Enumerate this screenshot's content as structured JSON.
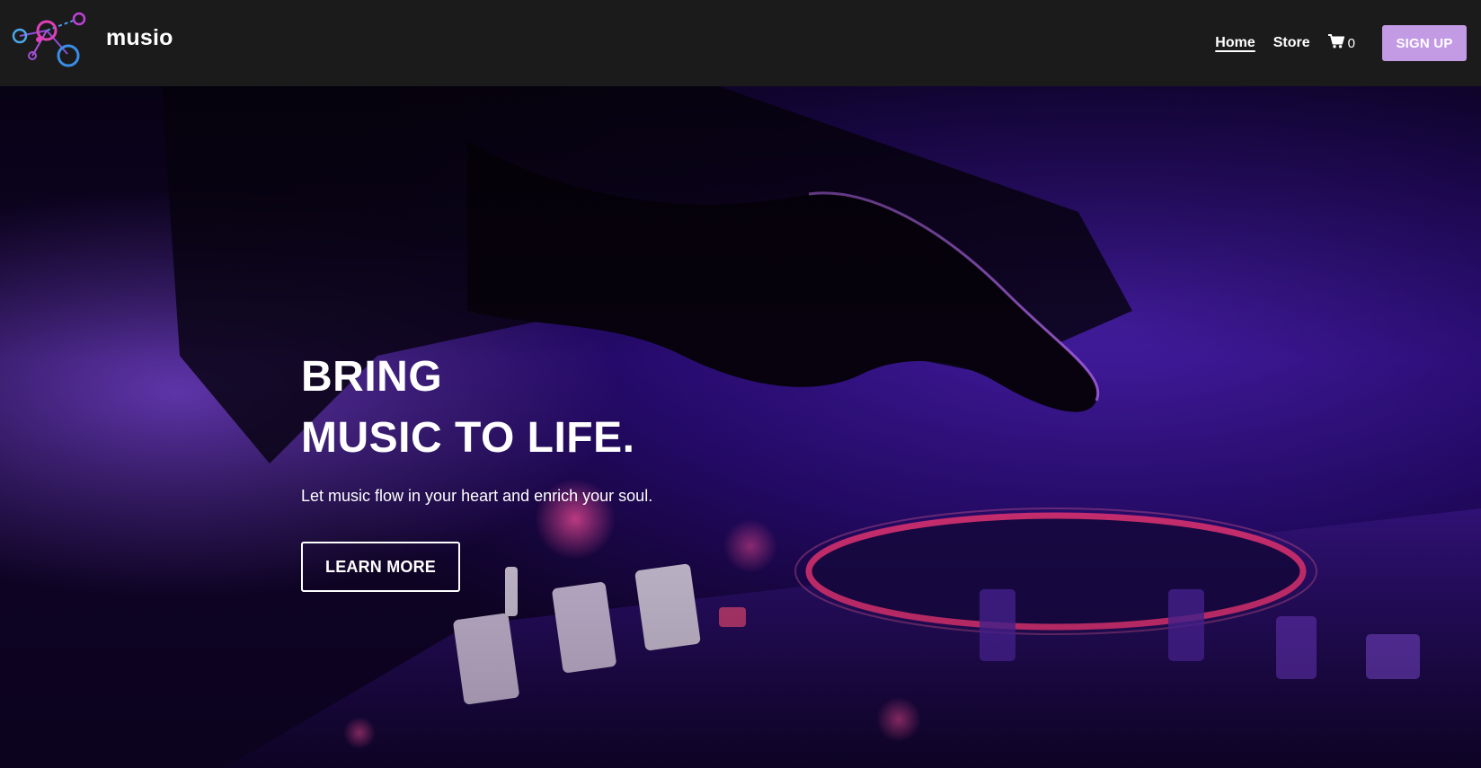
{
  "brand": {
    "name": "musio",
    "logo_icon": "molecule-circles-logo"
  },
  "nav": {
    "items": [
      {
        "label": "Home",
        "active": true
      },
      {
        "label": "Store",
        "active": false
      }
    ],
    "cart": {
      "icon": "shopping-cart-icon",
      "count": "0"
    },
    "signup_label": "SIGN UP"
  },
  "hero": {
    "title_line1": "BRING",
    "title_line2": "MUSIC TO LIFE.",
    "subtitle": "Let music flow in your heart and enrich your soul.",
    "cta_label": "LEARN MORE"
  },
  "colors": {
    "navbar_bg": "#1b1b1b",
    "accent": "#c39ae4",
    "hero_purple": "#5a1fd0",
    "hero_pink": "#ff3aa0",
    "text": "#ffffff"
  }
}
